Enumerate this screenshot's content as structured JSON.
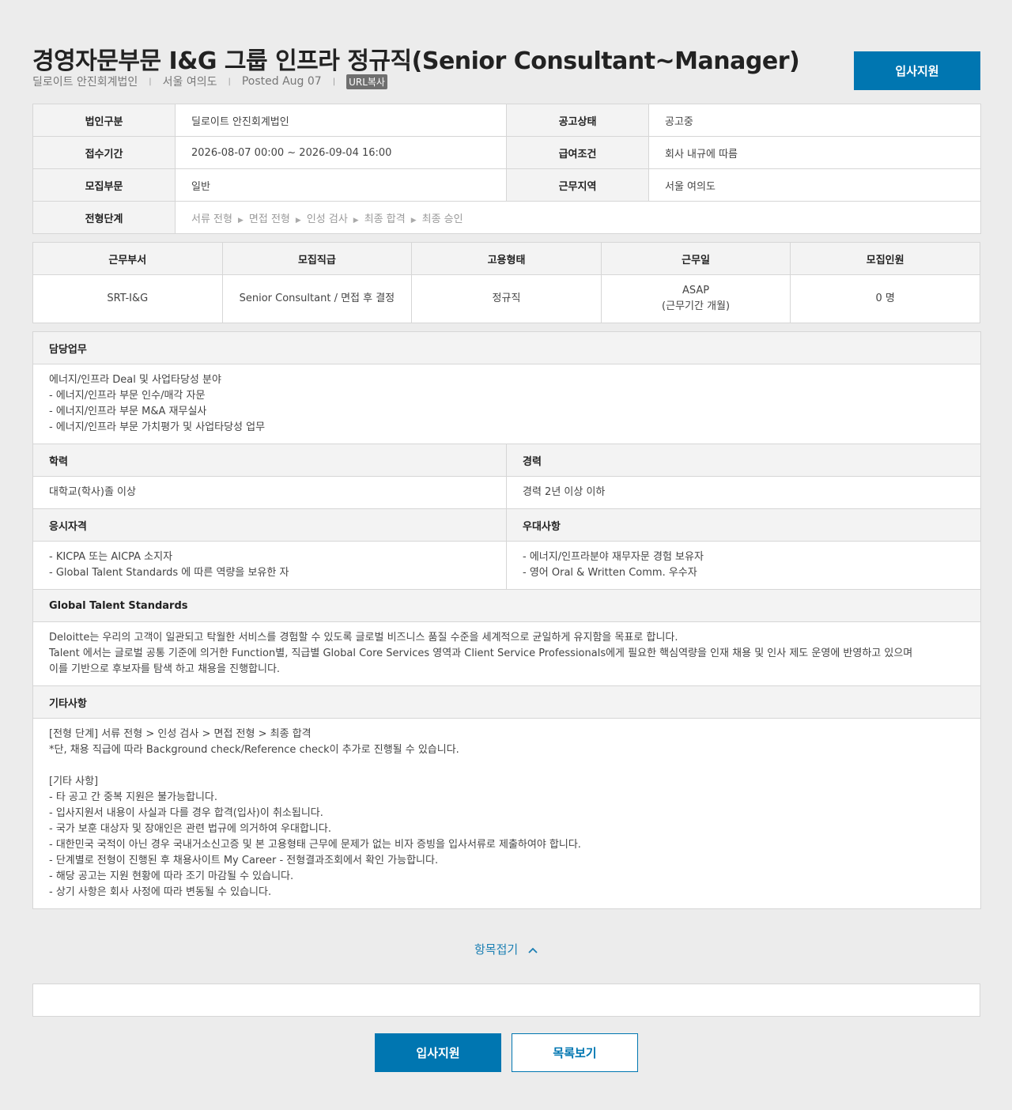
{
  "job": {
    "title": "경영자문부문 I&G 그룹 인프라 정규직(Senior Consultant~Manager)",
    "company": "딜로이트 안진회계법인",
    "location": "서울 여의도",
    "posted": "Posted Aug 07",
    "url_copy": "URL복사",
    "apply_label": "입사지원"
  },
  "info": {
    "corp_label": "법인구분",
    "corp_value": "딜로이트 안진회계법인",
    "status_label": "공고상태",
    "status_value": "공고중",
    "period_label": "접수기간",
    "period_value": "2026-08-07 00:00 ~ 2026-09-04 16:00",
    "salary_label": "급여조건",
    "salary_value": "회사 내규에 따름",
    "dept_label": "모집부문",
    "dept_value": "일반",
    "region_label": "근무지역",
    "region_value": "서울 여의도",
    "steps_label": "전형단계",
    "steps": [
      "서류 전형",
      "면접 전형",
      "인성 검사",
      "최종 합격",
      "최종 승인"
    ]
  },
  "grid": {
    "headers": [
      "근무부서",
      "모집직급",
      "고용형태",
      "근무일",
      "모집인원"
    ],
    "row": [
      "SRT-I&G",
      "Senior Consultant / 면접 후 결정",
      "정규직",
      "ASAP\n(근무기간 개월)",
      "0 명"
    ]
  },
  "detail": {
    "duty_label": "담당업무",
    "duty_text": "에너지/인프라 Deal 및 사업타당성 분야\n- 에너지/인프라 부문 인수/매각 자문\n- 에너지/인프라 부문 M&A 재무실사\n- 에너지/인프라 부문 가치평가 및 사업타당성 업무",
    "edu_label": "학력",
    "edu_value": "대학교(학사)졸 이상",
    "career_label": "경력",
    "career_value": "경력 2년 이상  이하",
    "qual_label": "응시자격",
    "qual_text": "- KICPA 또는 AICPA 소지자\n- Global Talent Standards 에 따른 역량을 보유한 자",
    "pref_label": "우대사항",
    "pref_text": "- 에너지/인프라분야 재무자문 경험 보유자\n- 영어 Oral & Written Comm. 우수자",
    "gts_label": "Global Talent Standards",
    "gts_text": "Deloitte는 우리의 고객이 일관되고 탁월한 서비스를 경험할 수 있도록 글로벌 비즈니스 품질 수준을 세계적으로 균일하게 유지함을 목표로 합니다.\nTalent 에서는 글로벌 공통 기준에 의거한 Function별, 직급별 Global Core Services 영역과 Client Service Professionals에게 필요한 핵심역량을 인재 채용 및 인사 제도 운영에 반영하고 있으며\n이를 기반으로 후보자를 탐색 하고 채용을 진행합니다.",
    "etc_label": "기타사항",
    "etc_text": "[전형 단계] 서류 전형 > 인성 검사 > 면접 전형 > 최종 합격\n*단, 채용 직급에 따라 Background check/Reference check이 추가로 진행될 수 있습니다.\n\n[기타 사항]\n- 타 공고 간 중복 지원은 불가능합니다.\n- 입사지원서 내용이 사실과 다를 경우 합격(입사)이 취소됩니다.\n- 국가 보훈 대상자 및 장애인은 관련 법규에 의거하여 우대합니다.\n- 대한민국 국적이 아닌 경우 국내거소신고증 및 본 고용형태 근무에 문제가 없는 비자 증빙을 입사서류로 제출하여야 합니다.\n- 단계별로 전형이 진행된 후 채용사이트 My Career - 전형결과조회에서 확인 가능합니다.\n- 해당 공고는 지원 현황에 따라 조기 마감될 수 있습니다.\n- 상기 사항은 회사 사정에 따라 변동될 수 있습니다."
  },
  "footer": {
    "fold_label": "항목접기",
    "apply_label": "입사지원",
    "list_label": "목록보기"
  }
}
